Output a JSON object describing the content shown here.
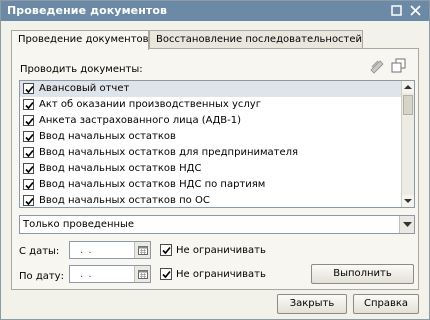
{
  "window": {
    "title": "Проведение документов"
  },
  "tabs": [
    {
      "label": "Проведение документов",
      "active": true
    },
    {
      "label": "Восстановление последовательностей",
      "active": false
    }
  ],
  "documents": {
    "label": "Проводить документы:",
    "items": [
      {
        "label": "Авансовый отчет",
        "checked": true,
        "selected": true
      },
      {
        "label": "Акт об оказании производственных услуг",
        "checked": true
      },
      {
        "label": "Анкета застрахованного лица (АДВ-1)",
        "checked": true
      },
      {
        "label": "Ввод начальных остатков",
        "checked": true
      },
      {
        "label": "Ввод начальных остатков для предпринимателя",
        "checked": true
      },
      {
        "label": "Ввод начальных остатков НДС",
        "checked": true
      },
      {
        "label": "Ввод начальных остатков НДС по партиям",
        "checked": true
      },
      {
        "label": "Ввод начальных остатков по ОС",
        "checked": true
      }
    ]
  },
  "filter": {
    "value": "Только проведенные"
  },
  "date_from": {
    "label": "С даты:",
    "value": ". .",
    "no_limit_label": "Не ограничивать",
    "no_limit": true
  },
  "date_to": {
    "label": "По дату:",
    "value": ". .",
    "no_limit_label": "Не ограничивать",
    "no_limit": true
  },
  "buttons": {
    "run": "Выполнить",
    "close": "Закрыть",
    "help": "Справка"
  },
  "colors": {
    "titlebar": "#6c8aa5",
    "window_bg": "#f2f1ea"
  }
}
